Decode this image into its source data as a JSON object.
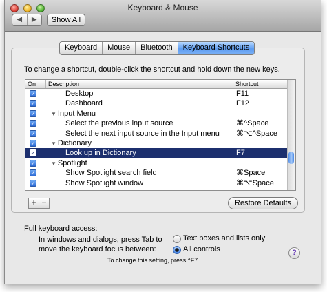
{
  "window": {
    "title": "Keyboard & Mouse"
  },
  "toolbar": {
    "back_glyph": "◀",
    "forward_glyph": "▶",
    "show_all_label": "Show All"
  },
  "tabs": [
    {
      "label": "Keyboard",
      "active": false
    },
    {
      "label": "Mouse",
      "active": false
    },
    {
      "label": "Bluetooth",
      "active": false
    },
    {
      "label": "Keyboard Shortcuts",
      "active": true
    }
  ],
  "instruction": "To change a shortcut, double-click the shortcut and hold down the new keys.",
  "table": {
    "headers": {
      "on": "On",
      "description": "Description",
      "shortcut": "Shortcut"
    },
    "rows": [
      {
        "checked": true,
        "group": false,
        "description": "Desktop",
        "shortcut": "F11"
      },
      {
        "checked": true,
        "group": false,
        "description": "Dashboard",
        "shortcut": "F12"
      },
      {
        "checked": true,
        "group": true,
        "description": "Input Menu",
        "shortcut": ""
      },
      {
        "checked": true,
        "group": false,
        "description": "Select the previous input source",
        "shortcut": "⌘^Space"
      },
      {
        "checked": true,
        "group": false,
        "description": "Select the next input source in the Input menu",
        "shortcut": "⌘⌥^Space"
      },
      {
        "checked": true,
        "group": true,
        "description": "Dictionary",
        "shortcut": ""
      },
      {
        "checked": true,
        "group": false,
        "description": "Look up in Dictionary",
        "shortcut": "F7",
        "selected": true
      },
      {
        "checked": true,
        "group": true,
        "description": "Spotlight",
        "shortcut": ""
      },
      {
        "checked": true,
        "group": false,
        "description": "Show Spotlight search field",
        "shortcut": "⌘Space"
      },
      {
        "checked": true,
        "group": false,
        "description": "Show Spotlight window",
        "shortcut": "⌘⌥Space"
      }
    ]
  },
  "buttons": {
    "add": "+",
    "remove": "−",
    "restore_defaults": "Restore Defaults"
  },
  "keyboard_access": {
    "label": "Full keyboard access:",
    "description_line1": "In windows and dialogs, press Tab to",
    "description_line2": "move the keyboard focus between:",
    "option_text_boxes": "Text boxes and lists only",
    "option_all_controls": "All controls",
    "selected": "All controls",
    "note": "To change this setting, press ^F7."
  },
  "help": {
    "glyph": "?"
  }
}
